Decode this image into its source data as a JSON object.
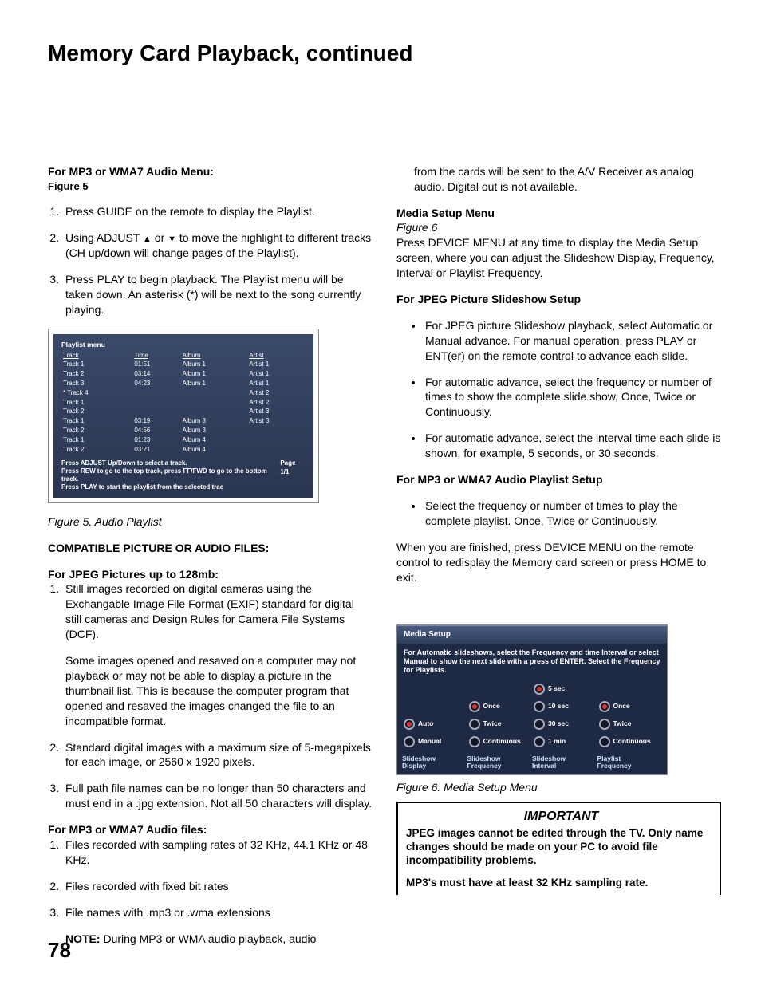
{
  "page_title": "Memory Card Playback, continued",
  "page_number": "78",
  "left": {
    "h1": "For MP3 or WMA7 Audio Menu:",
    "h1_sub": "Figure 5",
    "steps_a": [
      "Press GUIDE on the remote to display the Playlist.",
      "Using ADJUST ▲ or ▼ to move the highlight to different tracks (CH up/down will change pages of the Playlist).",
      "Press PLAY to begin playback.  The Playlist menu will be taken down. An asterisk (*) will be next to the song currently playing."
    ],
    "fig5_caption": "Figure 5.  Audio Playlist",
    "h2": "COMPATIBLE PICTURE OR AUDIO FILES:",
    "h3": "For JPEG Pictures up to 128mb:",
    "jpeg_items": [
      "Still images recorded on digital cameras using the Exchangable Image File Format (EXIF) standard for digital still cameras and Design Rules for Camera File Systems (DCF).",
      "Standard digital images with a maximum size of 5-megapixels for each image, or 2560 x 1920 pixels.",
      "Full path file names can be no longer than 50 characters and must end in a .jpg extension.  Not all 50 characters will display."
    ],
    "jpeg_1_extra": "Some images opened and resaved on a computer may not playback or may not be able to display a picture in the thumbnail list.  This is because the computer program that opened and resaved the images changed the file to an incompatible format.",
    "h4": "For MP3 or WMA7 Audio files:",
    "audio_items": [
      "Files recorded with sampling rates of 32 KHz, 44.1 KHz or 48 KHz.",
      "Files recorded with fixed bit rates",
      "File names with .mp3 or .wma extensions"
    ],
    "note_label": "NOTE:",
    "note_text": "  During MP3 or WMA audio playback, audio"
  },
  "right": {
    "carry": "from the cards will be sent to the A/V Receiver as analog audio.  Digital out is not available.",
    "h1": "Media Setup Menu",
    "h1_sub": "Figure 6",
    "h1_text": "Press DEVICE MENU at any time to display the Media Setup screen, where you can adjust the Slideshow Display, Frequency, Interval or Playlist Frequency.",
    "h2": "For JPEG Picture Slideshow Setup",
    "jpeg_bullets": [
      "For JPEG picture Slideshow playback, select Automatic or Manual advance.  For manual operation, press PLAY or ENT(er) on the remote control to advance each slide.",
      "For automatic advance, select the frequency or number of times to show the complete slide show, Once, Twice or Continuously.",
      "For automatic advance, select the interval time each slide is shown, for example, 5 seconds, or 30 seconds."
    ],
    "h3": "For MP3 or WMA7 Audio Playlist Setup",
    "mp3_bullets": [
      "Select the frequency or number of times to play the complete playlist.  Once, Twice or Continuously."
    ],
    "exit_text": "When you are finished, press DEVICE MENU on the remote control to redisplay the Memory card screen or press HOME to exit.",
    "fig6_caption": "Figure 6.  Media Setup Menu",
    "important_title": "IMPORTANT",
    "important_body": "JPEG images cannot be edited through the TV. Only name changes should be made on your PC to avoid file incompatibility problems.",
    "important_body2": "MP3's must have at least 32 KHz sampling rate."
  },
  "fig5": {
    "title": "Playlist menu",
    "headers": [
      "Track",
      "Time",
      "Album",
      "Artist"
    ],
    "rows": [
      [
        "Track 1",
        "01:51",
        "Album 1",
        "Artist 1"
      ],
      [
        "Track 2",
        "03:14",
        "Album 1",
        "Artist 1"
      ],
      [
        "Track 3",
        "04:23",
        "Album 1",
        "Artist 1"
      ],
      [
        "* Track 4",
        "",
        "",
        "Artist 2"
      ],
      [
        "Track 1",
        "",
        "",
        "Artist 2"
      ],
      [
        "Track 2",
        "",
        "",
        "Artist 3"
      ],
      [
        "Track 1",
        "03:19",
        "Album 3",
        "Artist 3"
      ],
      [
        "Track 2",
        "04:56",
        "Album 3",
        ""
      ],
      [
        "Track 1",
        "01:23",
        "Album 4",
        ""
      ],
      [
        "Track 2",
        "03:21",
        "Album 4",
        ""
      ]
    ],
    "help1": "Press ADJUST Up/Down to select a track.",
    "help2": "Press REW to go to the top track, press FF/FWD to go to the bottom track.",
    "help3": "Press PLAY to start the playlist from the selected trac",
    "page": "Page 1/1"
  },
  "fig6": {
    "title": "Media Setup",
    "desc": "For Automatic slideshows, select the Frequency and time Interval or select Manual to show the next slide with a press of ENTER. Select the Frequency for Playlists.",
    "cols": {
      "display": [
        "Auto",
        "Manual"
      ],
      "freq": [
        "Once",
        "Twice",
        "Continuous"
      ],
      "interval": [
        "5 sec",
        "10 sec",
        "30 sec",
        "1 min"
      ],
      "pfreq": [
        "Once",
        "Twice",
        "Continuous"
      ]
    },
    "headers": [
      "Slideshow Display",
      "Slideshow Frequency",
      "Slideshow Interval",
      "Playlist Frequency"
    ]
  }
}
